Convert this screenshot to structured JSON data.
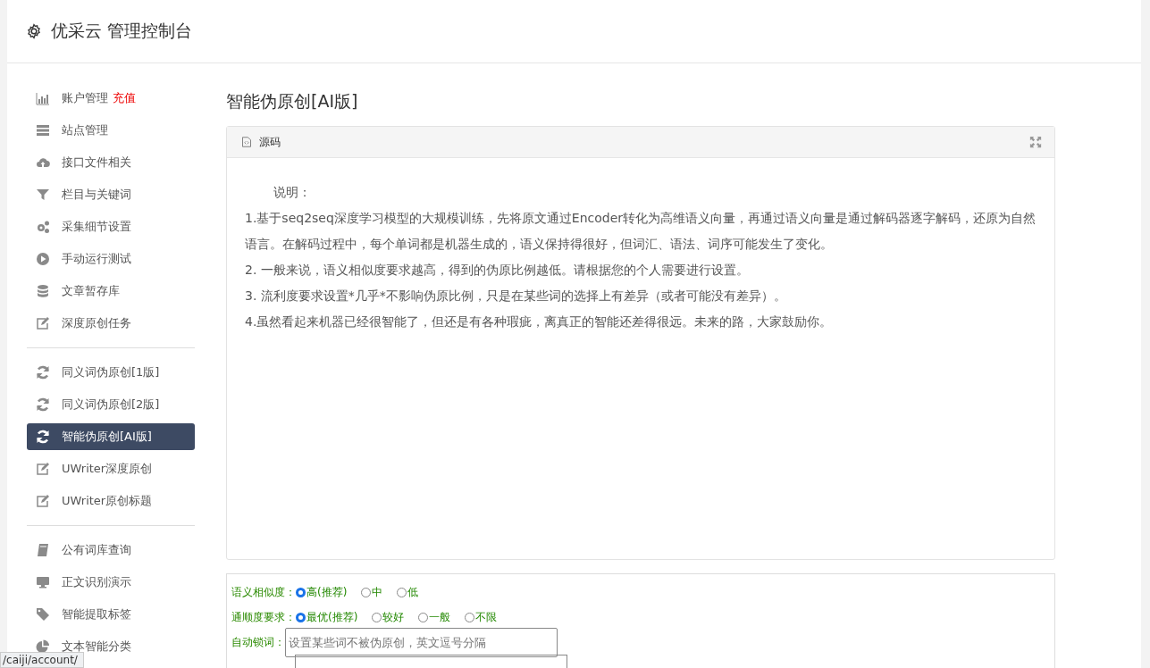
{
  "header": {
    "title": "优采云 管理控制台"
  },
  "sidebar": {
    "groups": [
      [
        {
          "label": "账户管理",
          "badge": "充值",
          "selected": false
        },
        {
          "label": "站点管理",
          "selected": false
        },
        {
          "label": "接口文件相关",
          "selected": false
        },
        {
          "label": "栏目与关键词",
          "selected": false
        },
        {
          "label": "采集细节设置",
          "selected": false
        },
        {
          "label": "手动运行测试",
          "selected": false
        },
        {
          "label": "文章暂存库",
          "selected": false
        },
        {
          "label": "深度原创任务",
          "selected": false
        }
      ],
      [
        {
          "label": "同义词伪原创[1版]",
          "selected": false
        },
        {
          "label": "同义词伪原创[2版]",
          "selected": false
        },
        {
          "label": "智能伪原创[AI版]",
          "selected": true
        },
        {
          "label": "UWriter深度原创",
          "selected": false
        },
        {
          "label": "UWriter原创标题",
          "selected": false
        }
      ],
      [
        {
          "label": "公有词库查询",
          "selected": false
        },
        {
          "label": "正文识别演示",
          "selected": false
        },
        {
          "label": "智能提取标签",
          "selected": false
        },
        {
          "label": "文本智能分类",
          "selected": false
        }
      ]
    ]
  },
  "main": {
    "title": "智能伪原创[AI版]",
    "panel": {
      "title": "源码",
      "paragraphs": [
        "说明：",
        "1.基于seq2seq深度学习模型的大规模训练，先将原文通过Encoder转化为高维语义向量，再通过语义向量是通过解码器逐字解码，还原为自然语言。在解码过程中，每个单词都是机器生成的，语义保持得很好，但词汇、语法、词序可能发生了变化。",
        "2. 一般来说，语义相似度要求越高，得到的伪原比例越低。请根据您的个人需要进行设置。",
        "3. 流利度要求设置*几乎*不影响伪原比例，只是在某些词的选择上有差异（或者可能没有差异）。",
        "4.虽然看起来机器已经很智能了，但还是有各种瑕疵，离真正的智能还差得很远。未来的路，大家鼓励你。"
      ]
    },
    "form": {
      "rows": [
        {
          "kind": "radio",
          "label": "语义相似度：",
          "options": [
            {
              "label": "高(推荐)",
              "selected": true
            },
            {
              "label": "中",
              "selected": false
            },
            {
              "label": "低",
              "selected": false
            }
          ]
        },
        {
          "kind": "radio",
          "label": "通顺度要求：",
          "options": [
            {
              "label": "最优(推荐)",
              "selected": true
            },
            {
              "label": "较好",
              "selected": false
            },
            {
              "label": "一般",
              "selected": false
            },
            {
              "label": "不限",
              "selected": false
            }
          ]
        },
        {
          "kind": "input",
          "label": "自动锁词：",
          "placeholder": "设置某些词不被伪原创，英文逗号分隔"
        },
        {
          "kind": "textarea"
        }
      ]
    }
  },
  "status_url": "/caiji/account/"
}
